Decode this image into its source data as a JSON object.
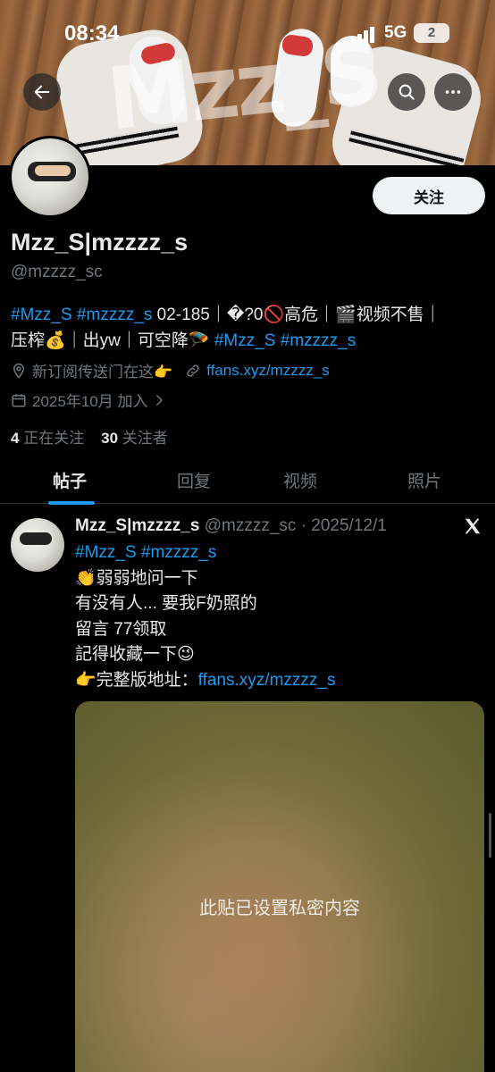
{
  "status_bar": {
    "time": "08:34",
    "network": "5G",
    "battery": "2"
  },
  "banner": {
    "watermark": "Mzz_S"
  },
  "profile": {
    "follow_label": "关注",
    "name": "Mzz_S|mzzzz_s",
    "handle": "@mzzzz_sc",
    "bio_line1": {
      "tag1": "#Mzz_S",
      "tag2": "#mzzzz_s",
      "text": " 02-185｜�?0🚫高危｜🎬视频不售｜"
    },
    "bio_line2": {
      "text": "压榨💰｜出yw｜可空降🪂 ",
      "tag1": "#Mzz_S",
      "tag2": "#mzzzz_s"
    },
    "location": "新订阅传送门在这👉",
    "website": "ffans.xyz/mzzzz_s",
    "joined": "2025年10月 加入",
    "following_count": "4",
    "following_label": "正在关注",
    "followers_count": "30",
    "followers_label": "关注者"
  },
  "tabs": [
    "帖子",
    "回复",
    "视频",
    "照片"
  ],
  "post": {
    "name": "Mzz_S|mzzzz_s",
    "handle_date": "@mzzzz_sc · 2025/12/1",
    "tags": "#Mzz_S #mzzzz_s",
    "line1": "👏弱弱地问一下",
    "line2": "有没有人... 要我F奶照的",
    "line3": "留言 77领取",
    "line4": "記得收藏一下😉",
    "line5_prefix": "👉完整版地址：",
    "line5_link": "ffans.xyz/mzzzz_s",
    "media_notice": "此贴已设置私密内容"
  },
  "icons": [
    "back-arrow-icon",
    "search-icon",
    "more-icon",
    "location-icon",
    "link-icon",
    "calendar-icon",
    "chevron-right-icon",
    "x-logo-icon"
  ]
}
